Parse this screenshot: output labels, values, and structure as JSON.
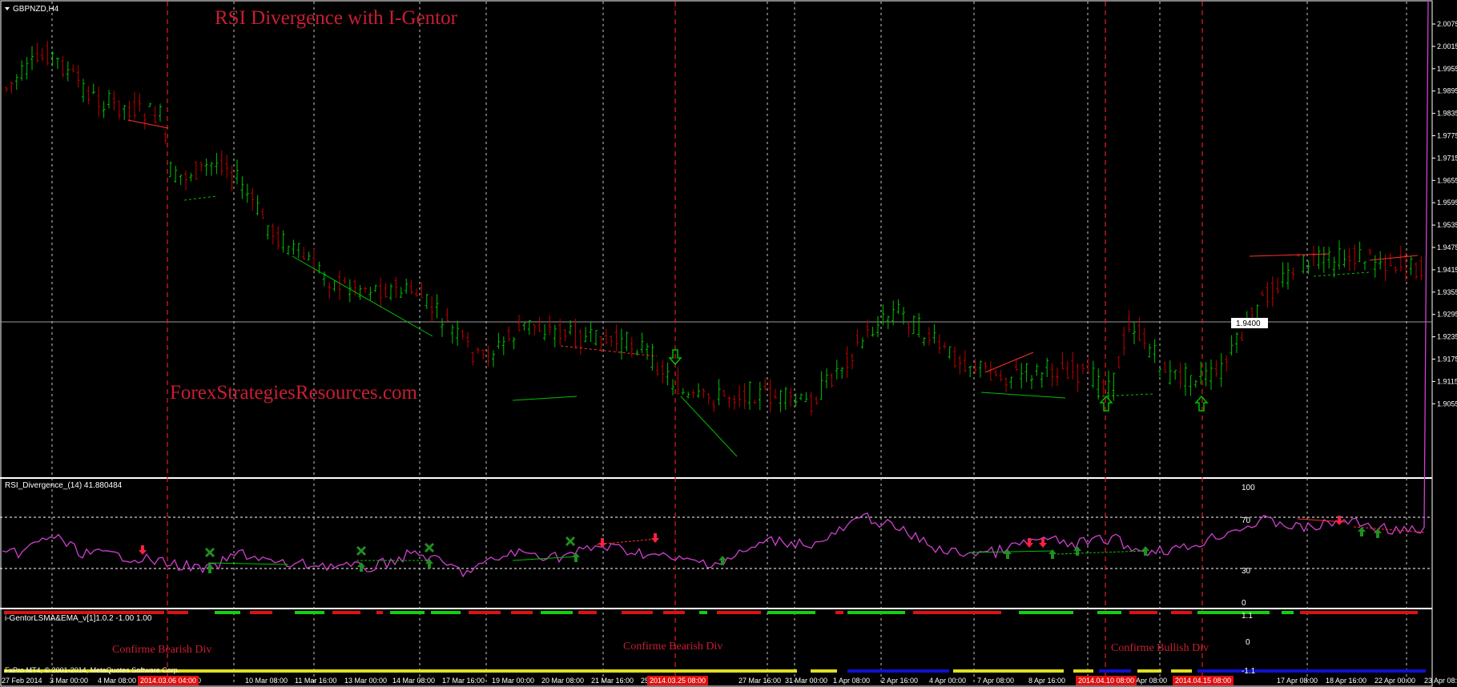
{
  "symbol_label": "GBPNZD,H4",
  "chart_title": "RSI Divergence with I-Gentor",
  "watermark": "ForexStrategiesResources.com",
  "current_price": "1.9400",
  "price_axis": [
    "2.0075",
    "2.0015",
    "1.9955",
    "1.9895",
    "1.9835",
    "1.9775",
    "1.9715",
    "1.9655",
    "1.9595",
    "1.9535",
    "1.9475",
    "1.9415",
    "1.9355",
    "1.9295",
    "1.9235",
    "1.9175",
    "1.9115",
    "1.9055"
  ],
  "rsi_panel": {
    "label": "RSI_Divergence_(14) 41.880484",
    "levels": [
      "100",
      "70",
      "30",
      "0"
    ]
  },
  "igentor_panel": {
    "label": "i-GentorLSMA&EMA_v[1]1.0.2 -1.00 1.00",
    "levels": [
      "1.1",
      "0",
      "-1.1"
    ]
  },
  "annotations": [
    "Confirme Bearish Div",
    "Confirme Bearish Div",
    "Confirme Bullish Div"
  ],
  "copyright": "FxPro MT4, © 2001-2014, MetaQuotes Software Corp.",
  "time_axis": [
    "27 Feb 2014",
    "3 Mar 00:00",
    "4 Mar 08:00",
    "7 Mar 00:00",
    "10 Mar 08:00",
    "11 Mar 16:00",
    "13 Mar 00:00",
    "14 Mar 08:00",
    "17 Mar 16:00",
    "19 Mar 00:00",
    "20 Mar 08:00",
    "21 Mar 16:00",
    "25",
    "r 08:00",
    "27 Mar 16:00",
    "31 Mar 00:00",
    "1 Apr 08:00",
    "2 Apr 16:00",
    "4 Apr 00:00",
    "7 Apr 08:00",
    "8 Apr 16:00",
    "Apr 08:00",
    "Apr 16:00",
    "17 Apr 08:00",
    "18 Apr 16:00",
    "22 Apr 00:00",
    "23 Apr 08:0"
  ],
  "time_highlights": [
    "2014.03.06 04:00",
    "2014.03.25 08:00",
    "2014.04.10 08:00",
    "2014.04.15 08:00"
  ],
  "colors": {
    "bull": "#00c000",
    "bear": "#c00000",
    "rsi": "#d040d0",
    "title": "#c81e32",
    "grid": "#c8c8c8"
  }
}
